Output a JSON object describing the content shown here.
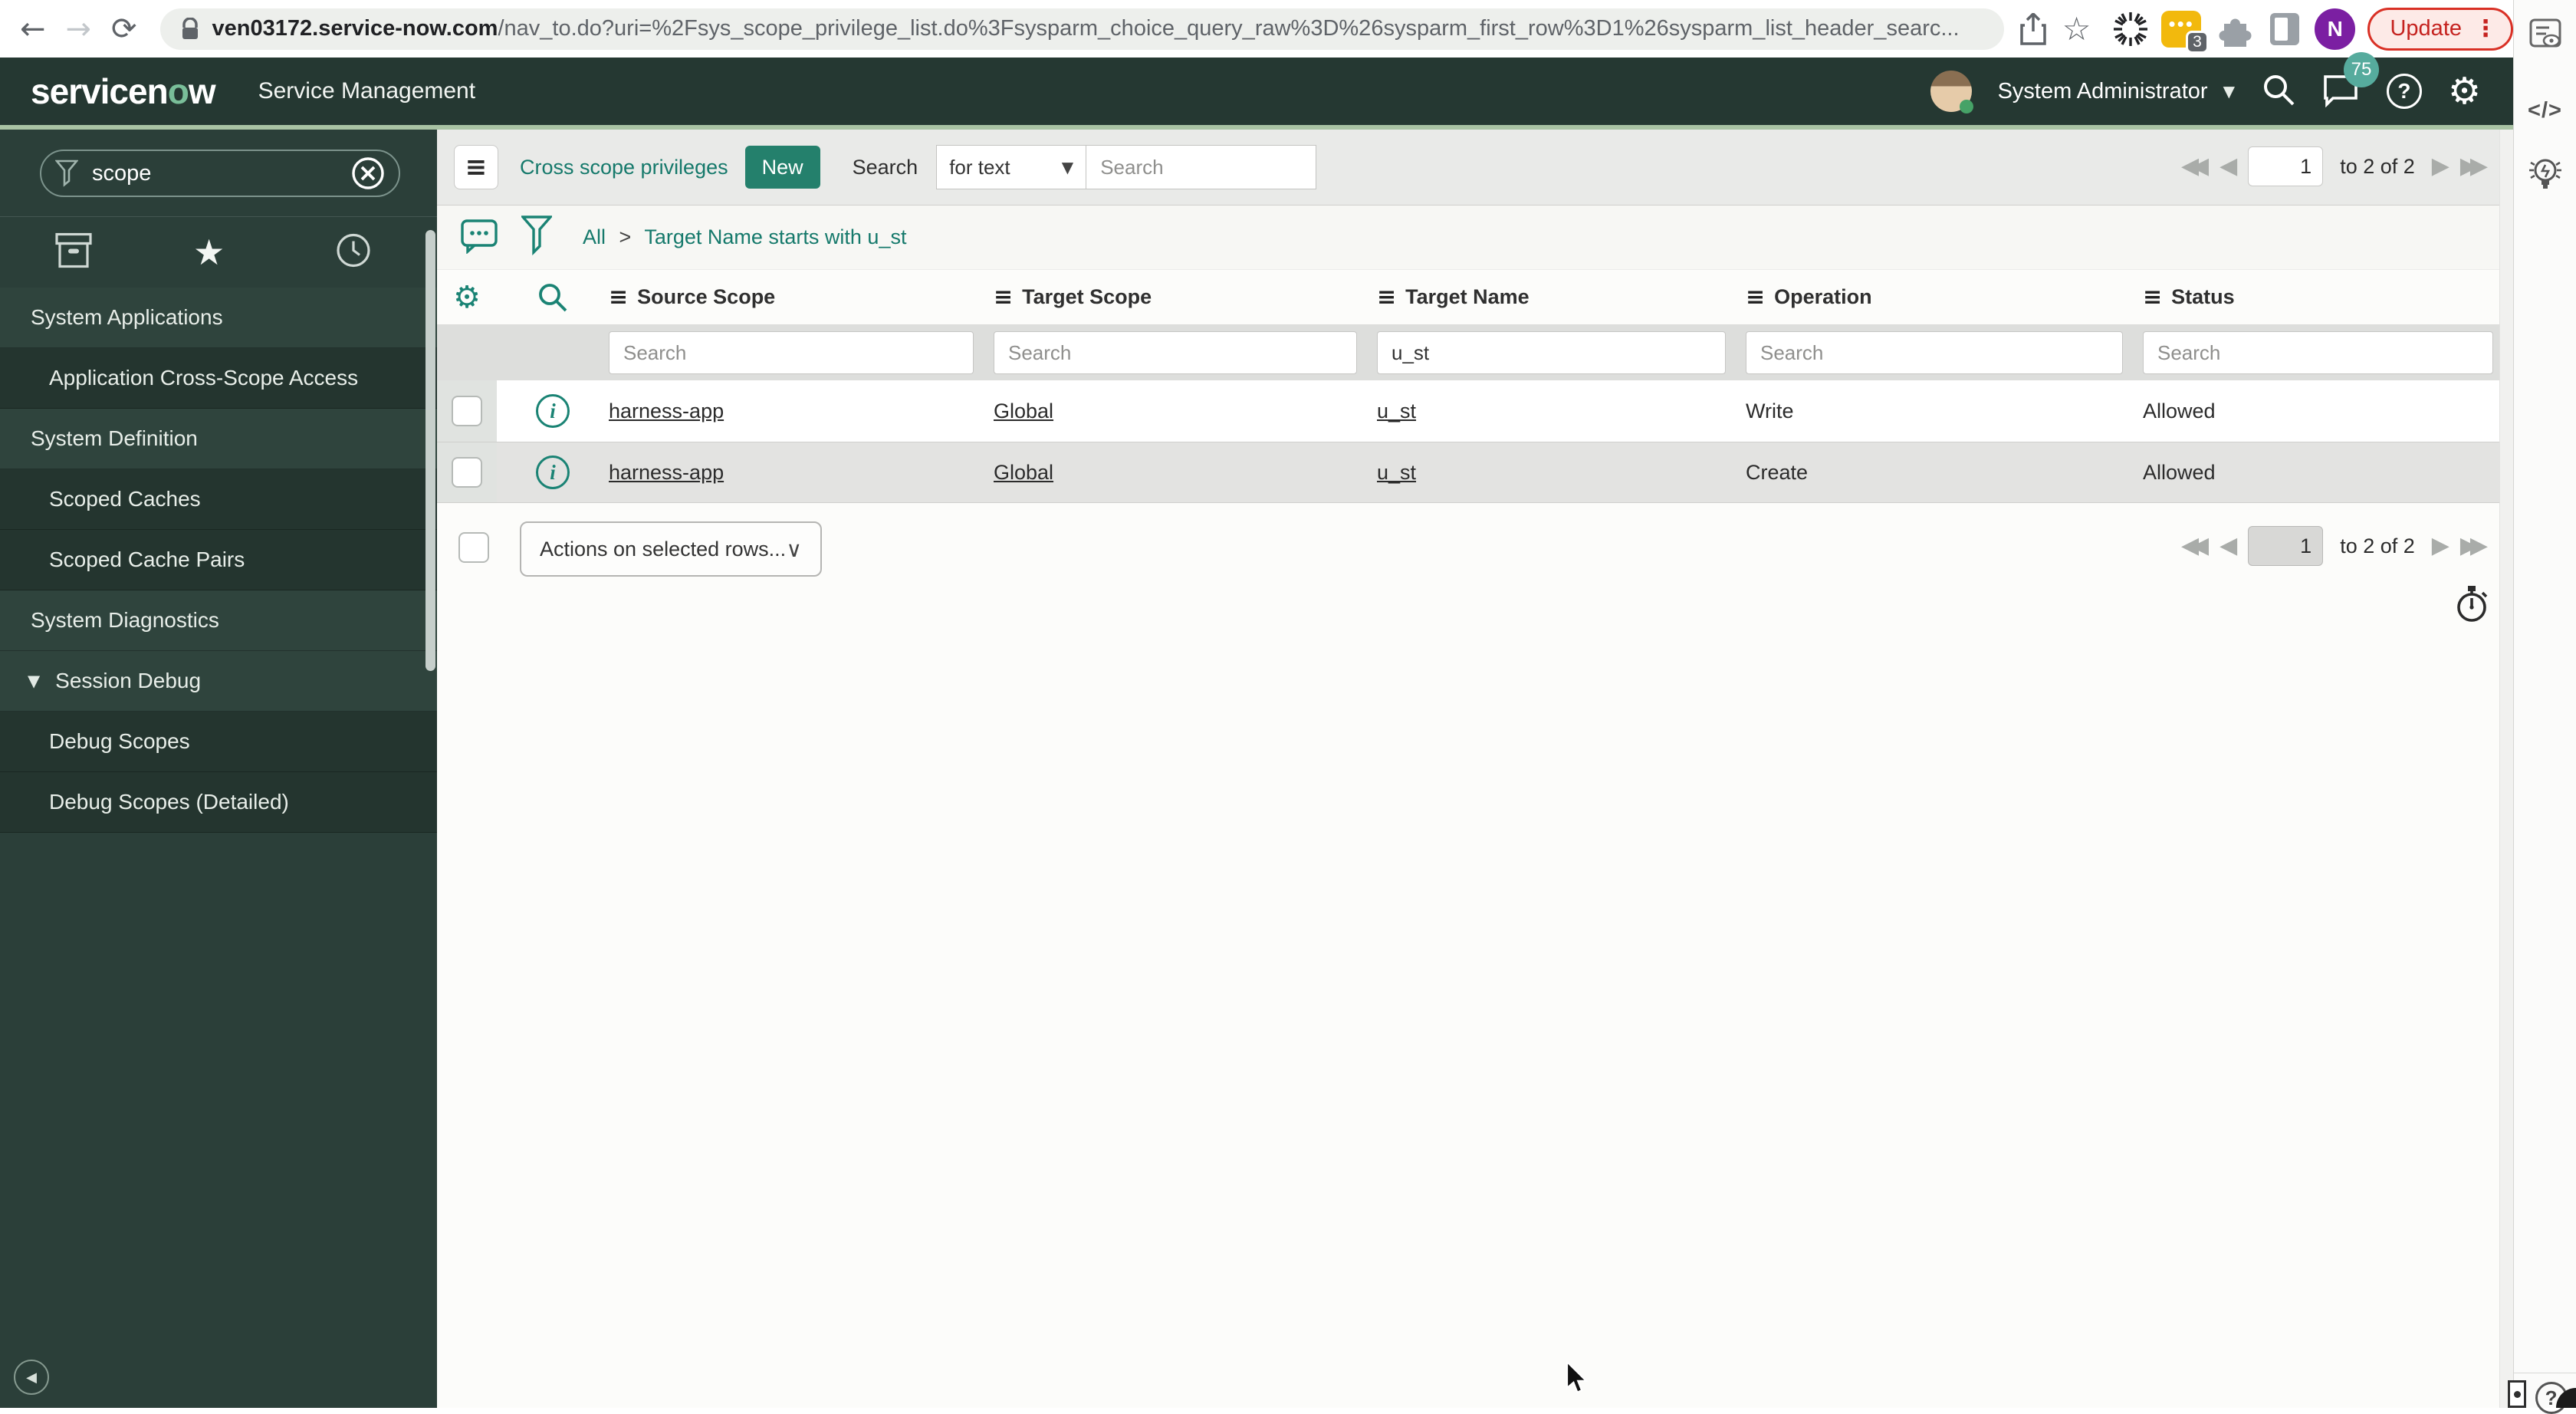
{
  "browser": {
    "url_host": "ven03172.service-now.com",
    "url_path": "/nav_to.do?uri=%2Fsys_scope_privilege_list.do%3Fsysparm_choice_query_raw%3D%26sysparm_first_row%3D1%26sysparm_list_header_searc...",
    "update_label": "Update",
    "profile_initial": "N",
    "extension_badge": "3"
  },
  "app_header": {
    "logo_left": "servicen",
    "logo_accent": "o",
    "logo_right": "w",
    "suite": "Service Management",
    "user_name": "System Administrator",
    "notification_count": "75"
  },
  "sidebar": {
    "search_value": "scope",
    "items": [
      {
        "label": "System Applications",
        "style": "header"
      },
      {
        "label": "Application Cross-Scope Access",
        "style": "sub"
      },
      {
        "label": "System Definition",
        "style": "header"
      },
      {
        "label": "Scoped Caches",
        "style": "sub"
      },
      {
        "label": "Scoped Cache Pairs",
        "style": "sub"
      },
      {
        "label": "System Diagnostics",
        "style": "header"
      },
      {
        "label": "Session Debug",
        "style": "header",
        "expanded": true
      },
      {
        "label": "Debug Scopes",
        "style": "sub"
      },
      {
        "label": "Debug Scopes (Detailed)",
        "style": "sub"
      }
    ]
  },
  "toolbar": {
    "title": "Cross scope privileges",
    "new_label": "New",
    "search_label": "Search",
    "search_mode": "for text",
    "search_placeholder": "Search"
  },
  "breadcrumb": {
    "root": "All",
    "separator": ">",
    "filter": "Target Name starts with u_st"
  },
  "table": {
    "columns": [
      "Source Scope",
      "Target Scope",
      "Target Name",
      "Operation",
      "Status"
    ],
    "filter_placeholder": "Search",
    "filters": [
      "",
      "",
      "u_st",
      "",
      ""
    ],
    "rows": [
      {
        "cells": [
          "harness-app",
          "Global",
          "u_st",
          "Write",
          "Allowed"
        ],
        "links": [
          true,
          true,
          true,
          false,
          false
        ]
      },
      {
        "cells": [
          "harness-app",
          "Global",
          "u_st",
          "Create",
          "Allowed"
        ],
        "links": [
          true,
          true,
          true,
          false,
          false
        ]
      }
    ]
  },
  "footer": {
    "actions_label": "Actions on selected rows..."
  },
  "pagination": {
    "page": "1",
    "range_label": "to 2 of 2"
  },
  "icons": {
    "back": "←",
    "forward": "→",
    "reload": "⟳",
    "star_outline": "☆",
    "star_filled": "★",
    "kebab": "⋮",
    "caret_down": "▼",
    "chevron_down": "∨",
    "collapse": "▼",
    "column_menu": "≡",
    "hamburger": "≡",
    "gear": "⚙",
    "help": "?",
    "code": "</>",
    "info": "i",
    "first": "◀◀",
    "prev": "◀",
    "next": "▶",
    "last": "▶▶",
    "chat_dots": "•••",
    "sidebar_collapse": "◀"
  },
  "colors": {
    "header_bg": "#253832",
    "accent_teal": "#1a8374",
    "header_accent_line": "#a9c3a4",
    "new_button": "#24806c",
    "update_red": "#c5221f",
    "badge_teal": "#56ab9d",
    "row_alt": "#e3e3e1"
  }
}
